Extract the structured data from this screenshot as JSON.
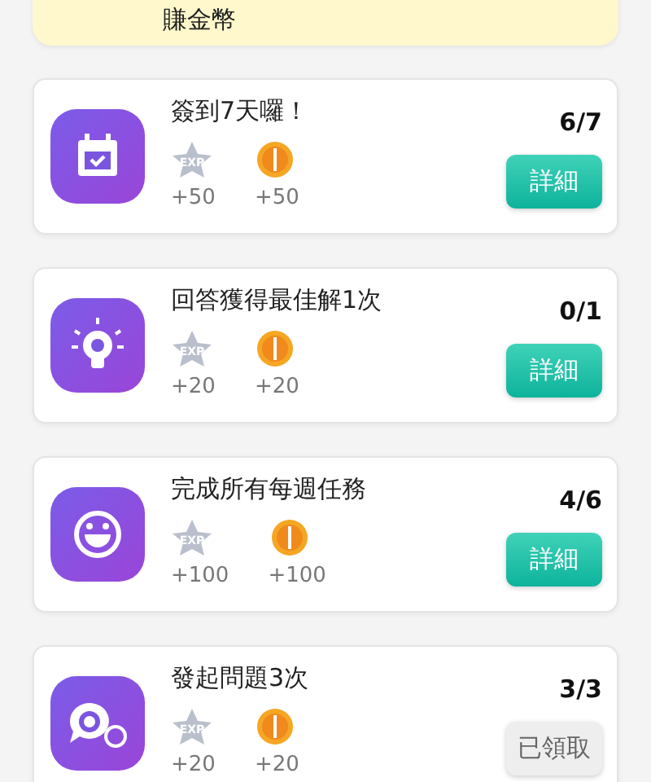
{
  "banner": {
    "text": "賺金幣"
  },
  "tasks": [
    {
      "kind": "calendar",
      "title": "簽到7天囉！",
      "progress": "6/7",
      "exp_badge": "EXP",
      "exp": "+50",
      "coins": "+50",
      "button": "詳細",
      "claimed": false
    },
    {
      "kind": "bulb",
      "title": "回答獲得最佳解1次",
      "progress": "0/1",
      "exp_badge": "EXP",
      "exp": "+20",
      "coins": "+20",
      "button": "詳細",
      "claimed": false
    },
    {
      "kind": "smile",
      "title": "完成所有每週任務",
      "progress": "4/6",
      "exp_badge": "EXP",
      "exp": "+100",
      "coins": "+100",
      "button": "詳細",
      "claimed": false
    },
    {
      "kind": "question",
      "title": "發起問題3次",
      "progress": "3/3",
      "exp_badge": "EXP",
      "exp": "+20",
      "coins": "+20",
      "button": "已領取",
      "claimed": true
    }
  ]
}
